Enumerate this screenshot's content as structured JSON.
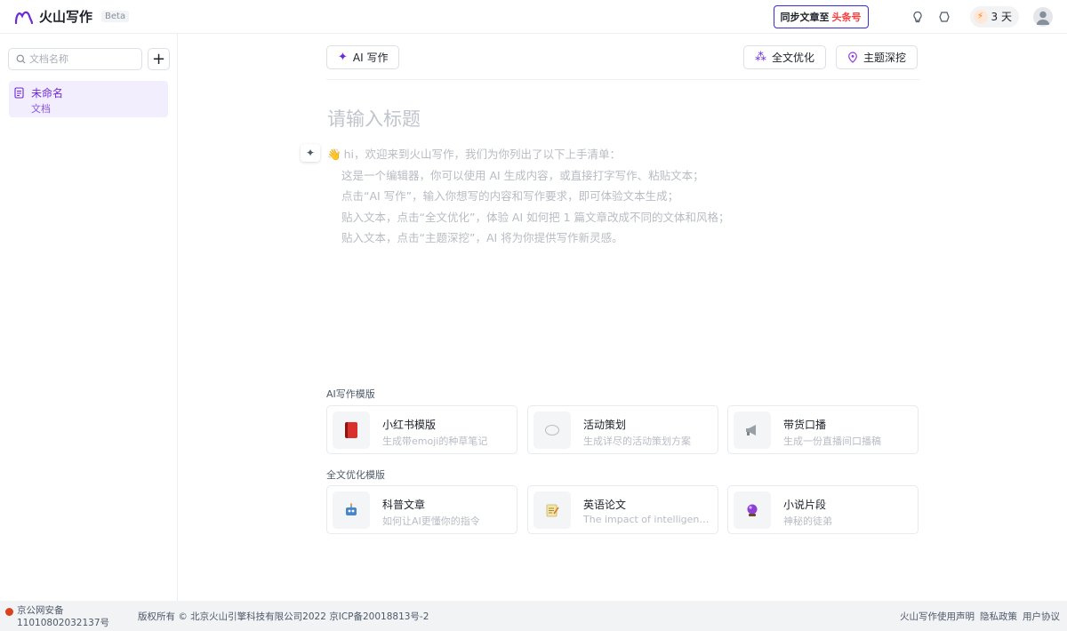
{
  "header": {
    "app_name": "火山写作",
    "beta": "Beta",
    "sync_label": "同步文章至",
    "sync_target": "头条号",
    "days": "3 天"
  },
  "sidebar": {
    "search_placeholder": "文档名称",
    "add_label": "+",
    "documents": [
      {
        "title": "未命名",
        "subtitle": "文档"
      }
    ]
  },
  "editor": {
    "ai_write_label": "AI 写作",
    "optimize_label": "全文优化",
    "topic_label": "主题深挖",
    "title_placeholder": "请输入标题",
    "intro_heading": "hi，欢迎来到火山写作，我们为你列出了以下上手清单：",
    "intro_lines": [
      "这是一个编辑器，你可以使用 AI 生成内容，或直接打字写作、粘贴文本；",
      "点击“AI 写作”，输入你想写的内容和写作要求，即可体验文本生成；",
      "贴入文本，点击“全文优化”，体验 AI 如何把 1 篇文章改成不同的文体和风格；",
      "贴入文本，点击“主题深挖”，AI 将为你提供写作新灵感。"
    ]
  },
  "templates": {
    "ai_section": "AI写作模版",
    "ai_cards": [
      {
        "title": "小红书模版",
        "desc": "生成带emoji的种草笔记",
        "icon": "red-book-icon"
      },
      {
        "title": "活动策划",
        "desc": "生成详尽的活动策划方案",
        "icon": "plan-icon"
      },
      {
        "title": "带货口播",
        "desc": "生成一份直播间口播稿",
        "icon": "megaphone-icon"
      }
    ],
    "optimize_section": "全文优化模版",
    "optimize_cards": [
      {
        "title": "科普文章",
        "desc": "如何让AI更懂你的指令",
        "icon": "robot-icon"
      },
      {
        "title": "英语论文",
        "desc": "The impact of intelligent h...",
        "icon": "memo-icon"
      },
      {
        "title": "小说片段",
        "desc": "神秘的徒弟",
        "icon": "crystal-ball-icon"
      }
    ]
  },
  "footer": {
    "beian": "京公网安备11010802032137号",
    "copyright": "版权所有 © 北京火山引擎科技有限公司2022   京ICP备20018813号-2",
    "links": [
      "火山写作使用声明",
      "隐私政策",
      "用户协议"
    ]
  }
}
